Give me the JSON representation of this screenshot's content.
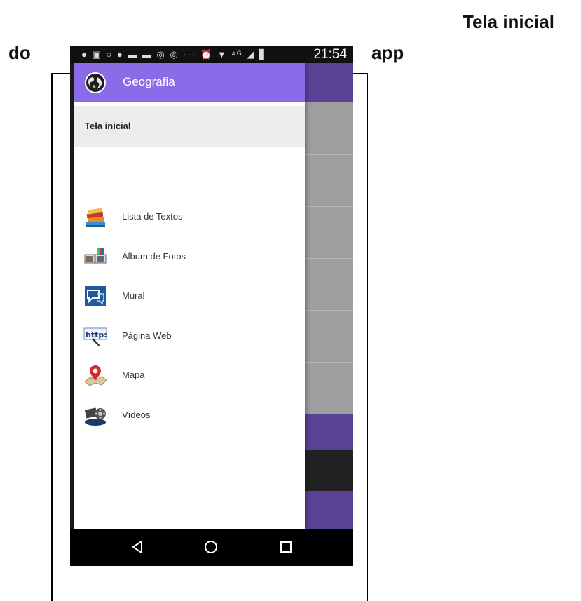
{
  "caption": {
    "line1": "Tela inicial",
    "left_word": "do",
    "right_word": "app"
  },
  "status_bar": {
    "icons": "● ▣ ○ ● ▬ ▬ ◎ ◎ ··· ⏰ ▼ ⁴ᴳ ◢ ▋",
    "time": "21:54"
  },
  "drawer": {
    "app_title": "Geografia",
    "app_icon": "globe-icon",
    "home_label": "Tela inicial",
    "items": [
      {
        "label": "Lista de Textos",
        "icon": "books-icon"
      },
      {
        "label": "Álbum de Fotos",
        "icon": "photo-album-icon"
      },
      {
        "label": "Mural",
        "icon": "mural-chat-icon"
      },
      {
        "label": "Página Web",
        "icon": "web-http-icon"
      },
      {
        "label": "Mapa",
        "icon": "map-pin-icon"
      },
      {
        "label": "Vídeos",
        "icon": "film-reel-icon"
      }
    ]
  },
  "nav_bar": {
    "buttons": [
      "back-icon",
      "home-icon",
      "recents-icon"
    ]
  },
  "colors": {
    "drawer_header": "#8b6be8",
    "app_toolbar": "#5b4196",
    "selected_item_bg": "#ececec"
  }
}
